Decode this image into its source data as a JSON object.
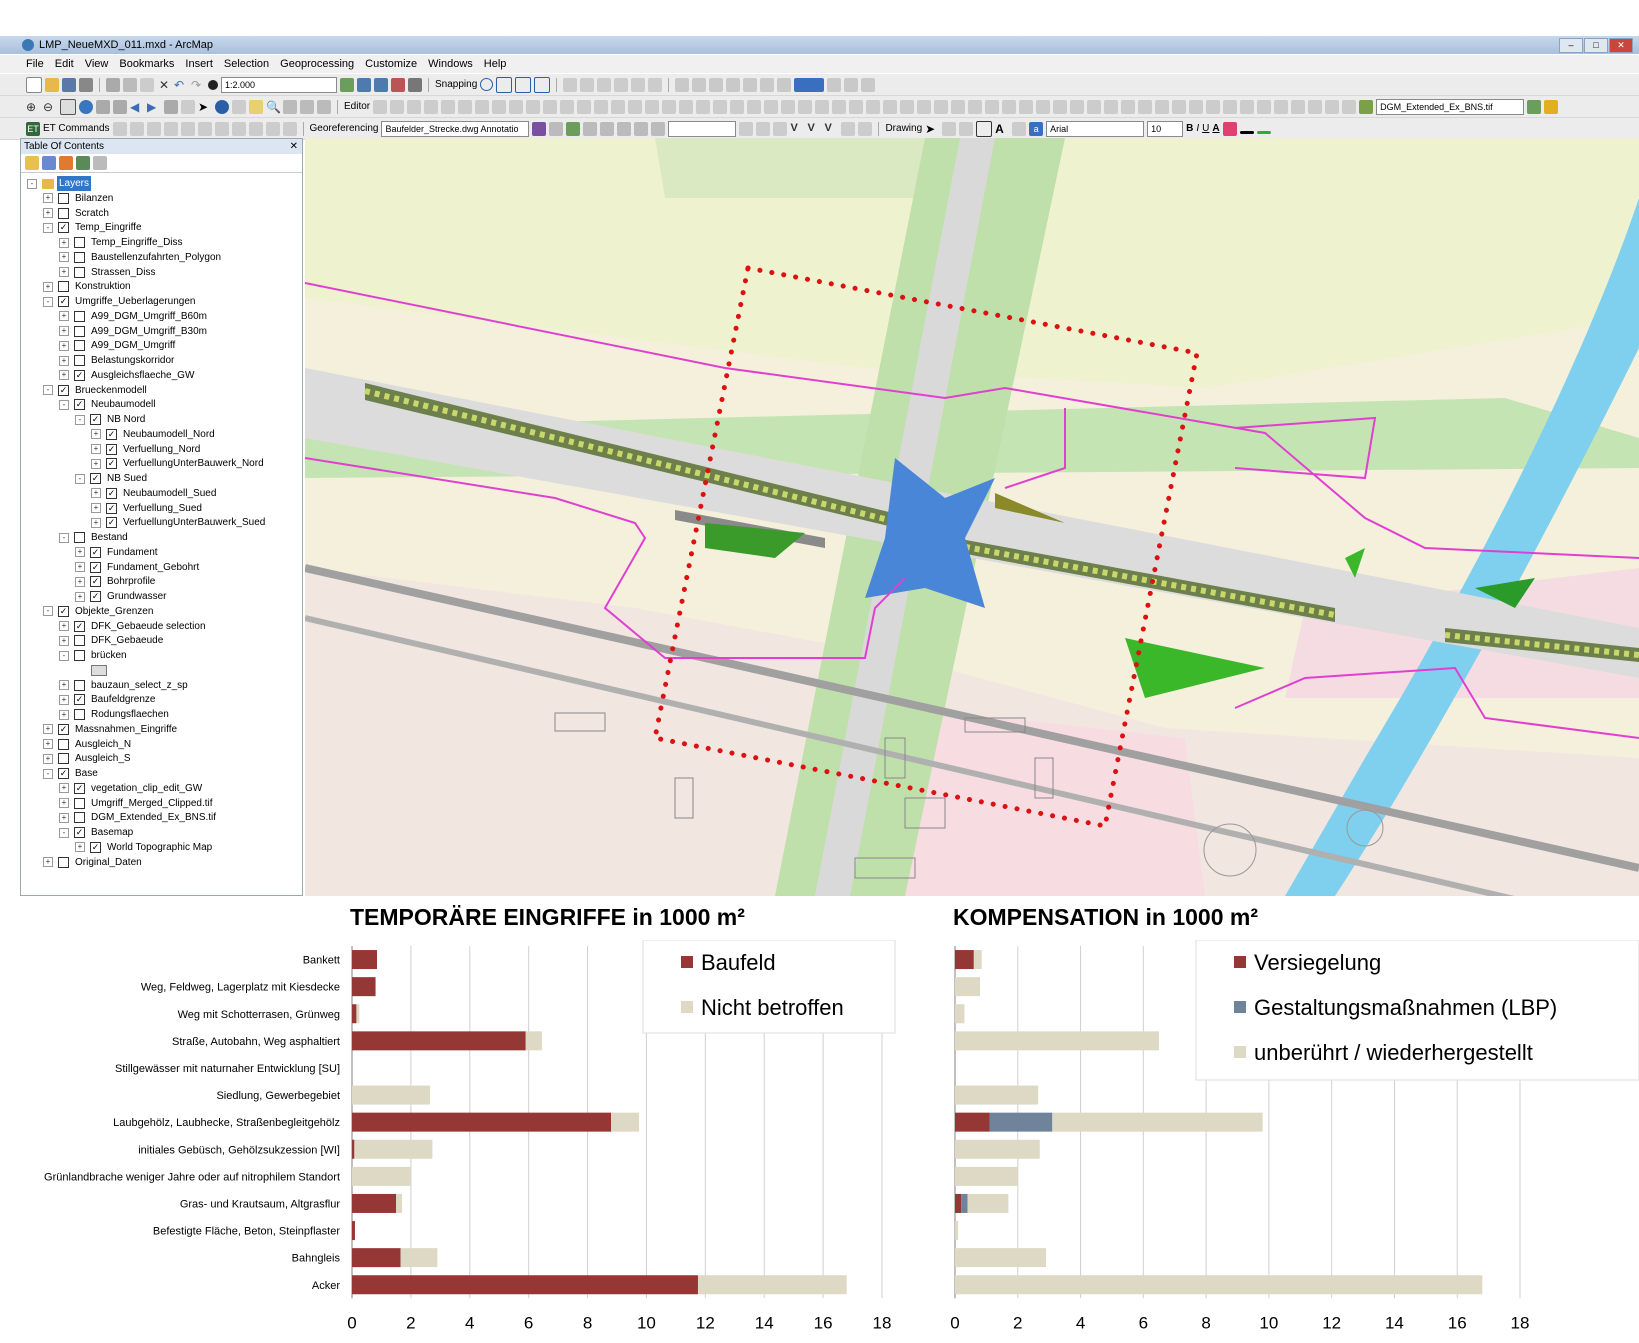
{
  "window": {
    "title": "LMP_NeueMXD_011.mxd - ArcMap"
  },
  "menu": [
    "File",
    "Edit",
    "View",
    "Bookmarks",
    "Insert",
    "Selection",
    "Geoprocessing",
    "Customize",
    "Windows",
    "Help"
  ],
  "toolbar": {
    "scale": "1:2.000",
    "snapping": "Snapping",
    "editor": "Editor",
    "raster_layer": "DGM_Extended_Ex_BNS.tif",
    "et_commands": "ET Commands",
    "georeferencing": "Georeferencing",
    "geo_layer": "Baufelder_Strecke.dwg Annotatio",
    "drawing": "Drawing",
    "font": "Arial",
    "font_size": "10",
    "bold": "B",
    "italic": "I",
    "underline": "U",
    "fontcolor": "A"
  },
  "toc": {
    "title": "Table Of Contents",
    "items": [
      {
        "label": "Layers",
        "level": 0,
        "checked": null,
        "exp": "-",
        "selected": true
      },
      {
        "label": "Bilanzen",
        "level": 1,
        "checked": false,
        "exp": "+"
      },
      {
        "label": "Scratch",
        "level": 1,
        "checked": false,
        "exp": "+"
      },
      {
        "label": "Temp_Eingriffe",
        "level": 1,
        "checked": true,
        "exp": "-"
      },
      {
        "label": "Temp_Eingriffe_Diss",
        "level": 2,
        "checked": false,
        "exp": "+"
      },
      {
        "label": "Baustellenzufahrten_Polygon",
        "level": 2,
        "checked": false,
        "exp": "+"
      },
      {
        "label": "Strassen_Diss",
        "level": 2,
        "checked": false,
        "exp": "+"
      },
      {
        "label": "Konstruktion",
        "level": 1,
        "checked": false,
        "exp": "+"
      },
      {
        "label": "Umgriffe_Ueberlagerungen",
        "level": 1,
        "checked": true,
        "exp": "-"
      },
      {
        "label": "A99_DGM_Umgriff_B60m",
        "level": 2,
        "checked": false,
        "exp": "+"
      },
      {
        "label": "A99_DGM_Umgriff_B30m",
        "level": 2,
        "checked": false,
        "exp": "+"
      },
      {
        "label": "A99_DGM_Umgriff",
        "level": 2,
        "checked": false,
        "exp": "+"
      },
      {
        "label": "Belastungskorridor",
        "level": 2,
        "checked": false,
        "exp": "+"
      },
      {
        "label": "Ausgleichsflaeche_GW",
        "level": 2,
        "checked": true,
        "exp": "+"
      },
      {
        "label": "Brueckenmodell",
        "level": 1,
        "checked": true,
        "exp": "-"
      },
      {
        "label": "Neubaumodell",
        "level": 2,
        "checked": true,
        "exp": "-"
      },
      {
        "label": "NB Nord",
        "level": 3,
        "checked": true,
        "exp": "-"
      },
      {
        "label": "Neubaumodell_Nord",
        "level": 4,
        "checked": true,
        "exp": "+"
      },
      {
        "label": "Verfuellung_Nord",
        "level": 4,
        "checked": true,
        "exp": "+"
      },
      {
        "label": "VerfuellungUnterBauwerk_Nord",
        "level": 4,
        "checked": true,
        "exp": "+"
      },
      {
        "label": "NB Sued",
        "level": 3,
        "checked": true,
        "exp": "-"
      },
      {
        "label": "Neubaumodell_Sued",
        "level": 4,
        "checked": true,
        "exp": "+"
      },
      {
        "label": "Verfuellung_Sued",
        "level": 4,
        "checked": true,
        "exp": "+"
      },
      {
        "label": "VerfuellungUnterBauwerk_Sued",
        "level": 4,
        "checked": true,
        "exp": "+"
      },
      {
        "label": "Bestand",
        "level": 2,
        "checked": false,
        "exp": "-"
      },
      {
        "label": "Fundament",
        "level": 3,
        "checked": true,
        "exp": "+"
      },
      {
        "label": "Fundament_Gebohrt",
        "level": 3,
        "checked": true,
        "exp": "+"
      },
      {
        "label": "Bohrprofile",
        "level": 3,
        "checked": true,
        "exp": "+"
      },
      {
        "label": "Grundwasser",
        "level": 3,
        "checked": true,
        "exp": "+"
      },
      {
        "label": "Objekte_Grenzen",
        "level": 1,
        "checked": true,
        "exp": "-"
      },
      {
        "label": "DFK_Gebaeude selection",
        "level": 2,
        "checked": true,
        "exp": "+"
      },
      {
        "label": "DFK_Gebaeude",
        "level": 2,
        "checked": false,
        "exp": "+"
      },
      {
        "label": "brücken",
        "level": 2,
        "checked": false,
        "exp": "-"
      },
      {
        "label": "",
        "level": 3,
        "checked": null,
        "exp": "",
        "swatch": true
      },
      {
        "label": "bauzaun_select_z_sp",
        "level": 2,
        "checked": false,
        "exp": "+"
      },
      {
        "label": "Baufeldgrenze",
        "level": 2,
        "checked": true,
        "exp": "+"
      },
      {
        "label": "Rodungsflaechen",
        "level": 2,
        "checked": false,
        "exp": "+"
      },
      {
        "label": "Massnahmen_Eingriffe",
        "level": 1,
        "checked": true,
        "exp": "+"
      },
      {
        "label": "Ausgleich_N",
        "level": 1,
        "checked": false,
        "exp": "+"
      },
      {
        "label": "Ausgleich_S",
        "level": 1,
        "checked": false,
        "exp": "+"
      },
      {
        "label": "Base",
        "level": 1,
        "checked": true,
        "exp": "-"
      },
      {
        "label": "vegetation_clip_edit_GW",
        "level": 2,
        "checked": true,
        "exp": "+"
      },
      {
        "label": "Umgriff_Merged_Clipped.tif",
        "level": 2,
        "checked": false,
        "exp": "+"
      },
      {
        "label": "DGM_Extended_Ex_BNS.tif",
        "level": 2,
        "checked": false,
        "exp": "+"
      },
      {
        "label": "Basemap",
        "level": 2,
        "checked": true,
        "exp": "-"
      },
      {
        "label": "World Topographic Map",
        "level": 3,
        "checked": true,
        "exp": "+"
      },
      {
        "label": "Original_Daten",
        "level": 1,
        "checked": false,
        "exp": "+"
      }
    ]
  },
  "chart_data": [
    {
      "type": "bar",
      "stacked": true,
      "orientation": "horizontal",
      "title": "TEMPORÄRE EINGRIFFE  in 1000 m²",
      "categories": [
        "Bankett",
        "Weg, Feldweg, Lagerplatz mit Kiesdecke",
        "Weg mit Schotterrasen, Grünweg",
        "Straße, Autobahn, Weg asphaltiert",
        "Stillgewässer mit naturnaher Entwicklung [SU]",
        "Siedlung, Gewerbegebiet",
        "Laubgehölz, Laubhecke, Straßenbegleitgehölz",
        "initiales Gebüsch, Gehölzsukzession [WI]",
        "Grünlandbrache weniger Jahre oder auf nitrophilem Standort",
        "Gras- und Krautsaum, Altgrasflur",
        "Befestigte Fläche, Beton, Steinpflaster",
        "Bahngleis",
        "Acker"
      ],
      "series": [
        {
          "name": "Baufeld",
          "color": "#953735",
          "values": [
            0.85,
            0.8,
            0.15,
            5.9,
            0,
            0,
            8.8,
            0.08,
            0,
            1.5,
            0.1,
            1.65,
            11.75
          ]
        },
        {
          "name": "Nicht betroffen",
          "color": "#ddd9c4",
          "values": [
            0,
            0,
            0.1,
            0.55,
            0,
            2.65,
            0.95,
            2.65,
            2.0,
            0.2,
            0,
            1.25,
            5.05
          ]
        }
      ],
      "xlim": [
        0,
        18
      ],
      "xticks": [
        0,
        2,
        4,
        6,
        8,
        10,
        12,
        14,
        16,
        18
      ],
      "grid": true,
      "legend": "top-right"
    },
    {
      "type": "bar",
      "stacked": true,
      "orientation": "horizontal",
      "title": "KOMPENSATION in 1000 m²",
      "categories": [
        "Bankett",
        "Weg, Feldweg, Lagerplatz mit Kiesdecke",
        "Weg mit Schotterrasen, Grünweg",
        "Straße, Autobahn, Weg asphaltiert",
        "Stillgewässer mit naturnaher Entwicklung [SU]",
        "Siedlung, Gewerbegebiet",
        "Laubgehölz, Laubhecke, Straßenbegleitgehölz",
        "initiales Gebüsch, Gehölzsukzession [WI]",
        "Grünlandbrache weniger Jahre oder auf nitrophilem Standort",
        "Gras- und Krautsaum, Altgrasflur",
        "Befestigte Fläche, Beton, Steinpflaster",
        "Bahngleis",
        "Acker"
      ],
      "series": [
        {
          "name": "Versiegelung",
          "color": "#953735",
          "values": [
            0.6,
            0,
            0,
            0,
            0,
            0,
            1.1,
            0,
            0,
            0.2,
            0,
            0,
            0
          ]
        },
        {
          "name": "Gestaltungsmaßnahmen (LBP)",
          "color": "#6f849a",
          "values": [
            0,
            0,
            0,
            0,
            0,
            0,
            2.0,
            0,
            0,
            0.2,
            0,
            0,
            0
          ]
        },
        {
          "name": "unberührt / wiederhergestellt",
          "color": "#ddd9c4",
          "values": [
            0.25,
            0.8,
            0.3,
            6.5,
            0,
            2.65,
            6.7,
            2.7,
            2.0,
            1.3,
            0.1,
            2.9,
            16.8
          ]
        }
      ],
      "xlim": [
        0,
        18
      ],
      "xticks": [
        0,
        2,
        4,
        6,
        8,
        10,
        12,
        14,
        16,
        18
      ],
      "grid": true,
      "legend": "top-right"
    }
  ]
}
